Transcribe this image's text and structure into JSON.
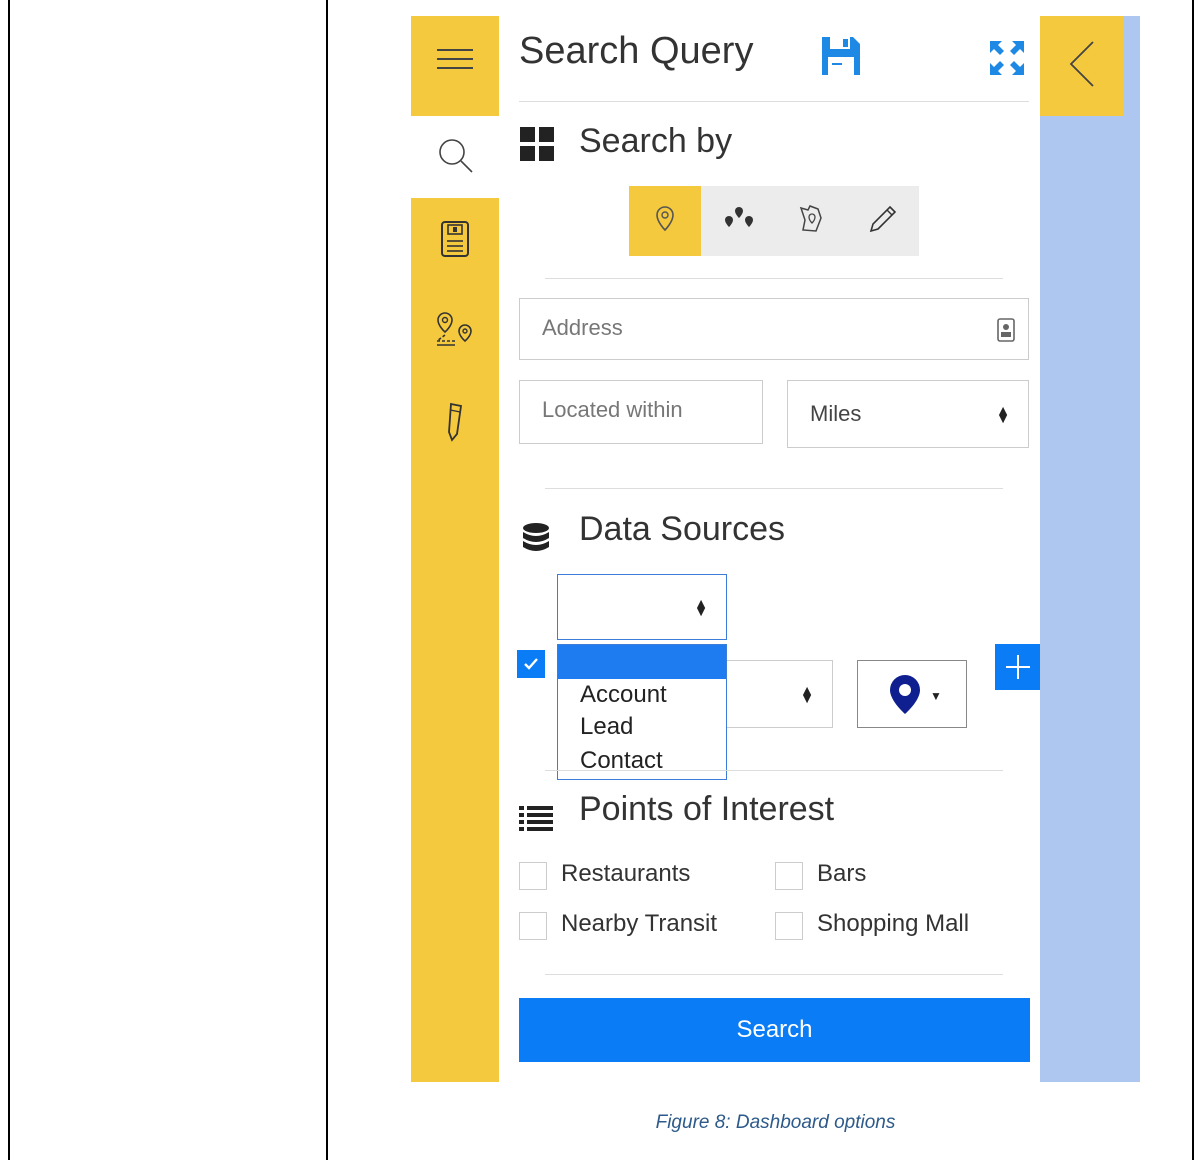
{
  "panel": {
    "title": "Search Query",
    "icons": {
      "menu": "hamburger-icon",
      "save": "floppy-disk-icon",
      "expand": "expand-arrows-icon",
      "collapse": "chevron-left-icon"
    }
  },
  "sidebar": {
    "items": [
      {
        "icon": "hamburger-icon"
      },
      {
        "icon": "search-icon",
        "active": true
      },
      {
        "icon": "saved-queries-icon"
      },
      {
        "icon": "route-icon"
      },
      {
        "icon": "pencil-icon"
      }
    ]
  },
  "search_by": {
    "title": "Search by",
    "modes": [
      {
        "icon": "location-pin-icon",
        "active": true
      },
      {
        "icon": "multi-location-icon"
      },
      {
        "icon": "area-map-icon"
      },
      {
        "icon": "draw-pencil-icon"
      }
    ]
  },
  "address": {
    "placeholder": "Address",
    "icon": "address-card-icon"
  },
  "radius": {
    "placeholder": "Located within",
    "unit_selected": "Miles"
  },
  "data_sources": {
    "title": "Data Sources",
    "row_checked": true,
    "dropdown_options": [
      "",
      "Account",
      "Lead",
      "Contact"
    ],
    "colors": {
      "marker": "#0f1f8f",
      "add_button": "#0a7cf5"
    }
  },
  "poi": {
    "title": "Points of Interest",
    "options": [
      {
        "label": "Restaurants",
        "checked": false
      },
      {
        "label": "Bars",
        "checked": false
      },
      {
        "label": "Nearby Transit",
        "checked": false
      },
      {
        "label": "Shopping Mall",
        "checked": false
      }
    ]
  },
  "actions": {
    "search_label": "Search"
  },
  "caption": "Figure 8: Dashboard options",
  "colors": {
    "rail": "#f5c93e",
    "map": "#aec7f0",
    "primary": "#0a7cf5"
  }
}
